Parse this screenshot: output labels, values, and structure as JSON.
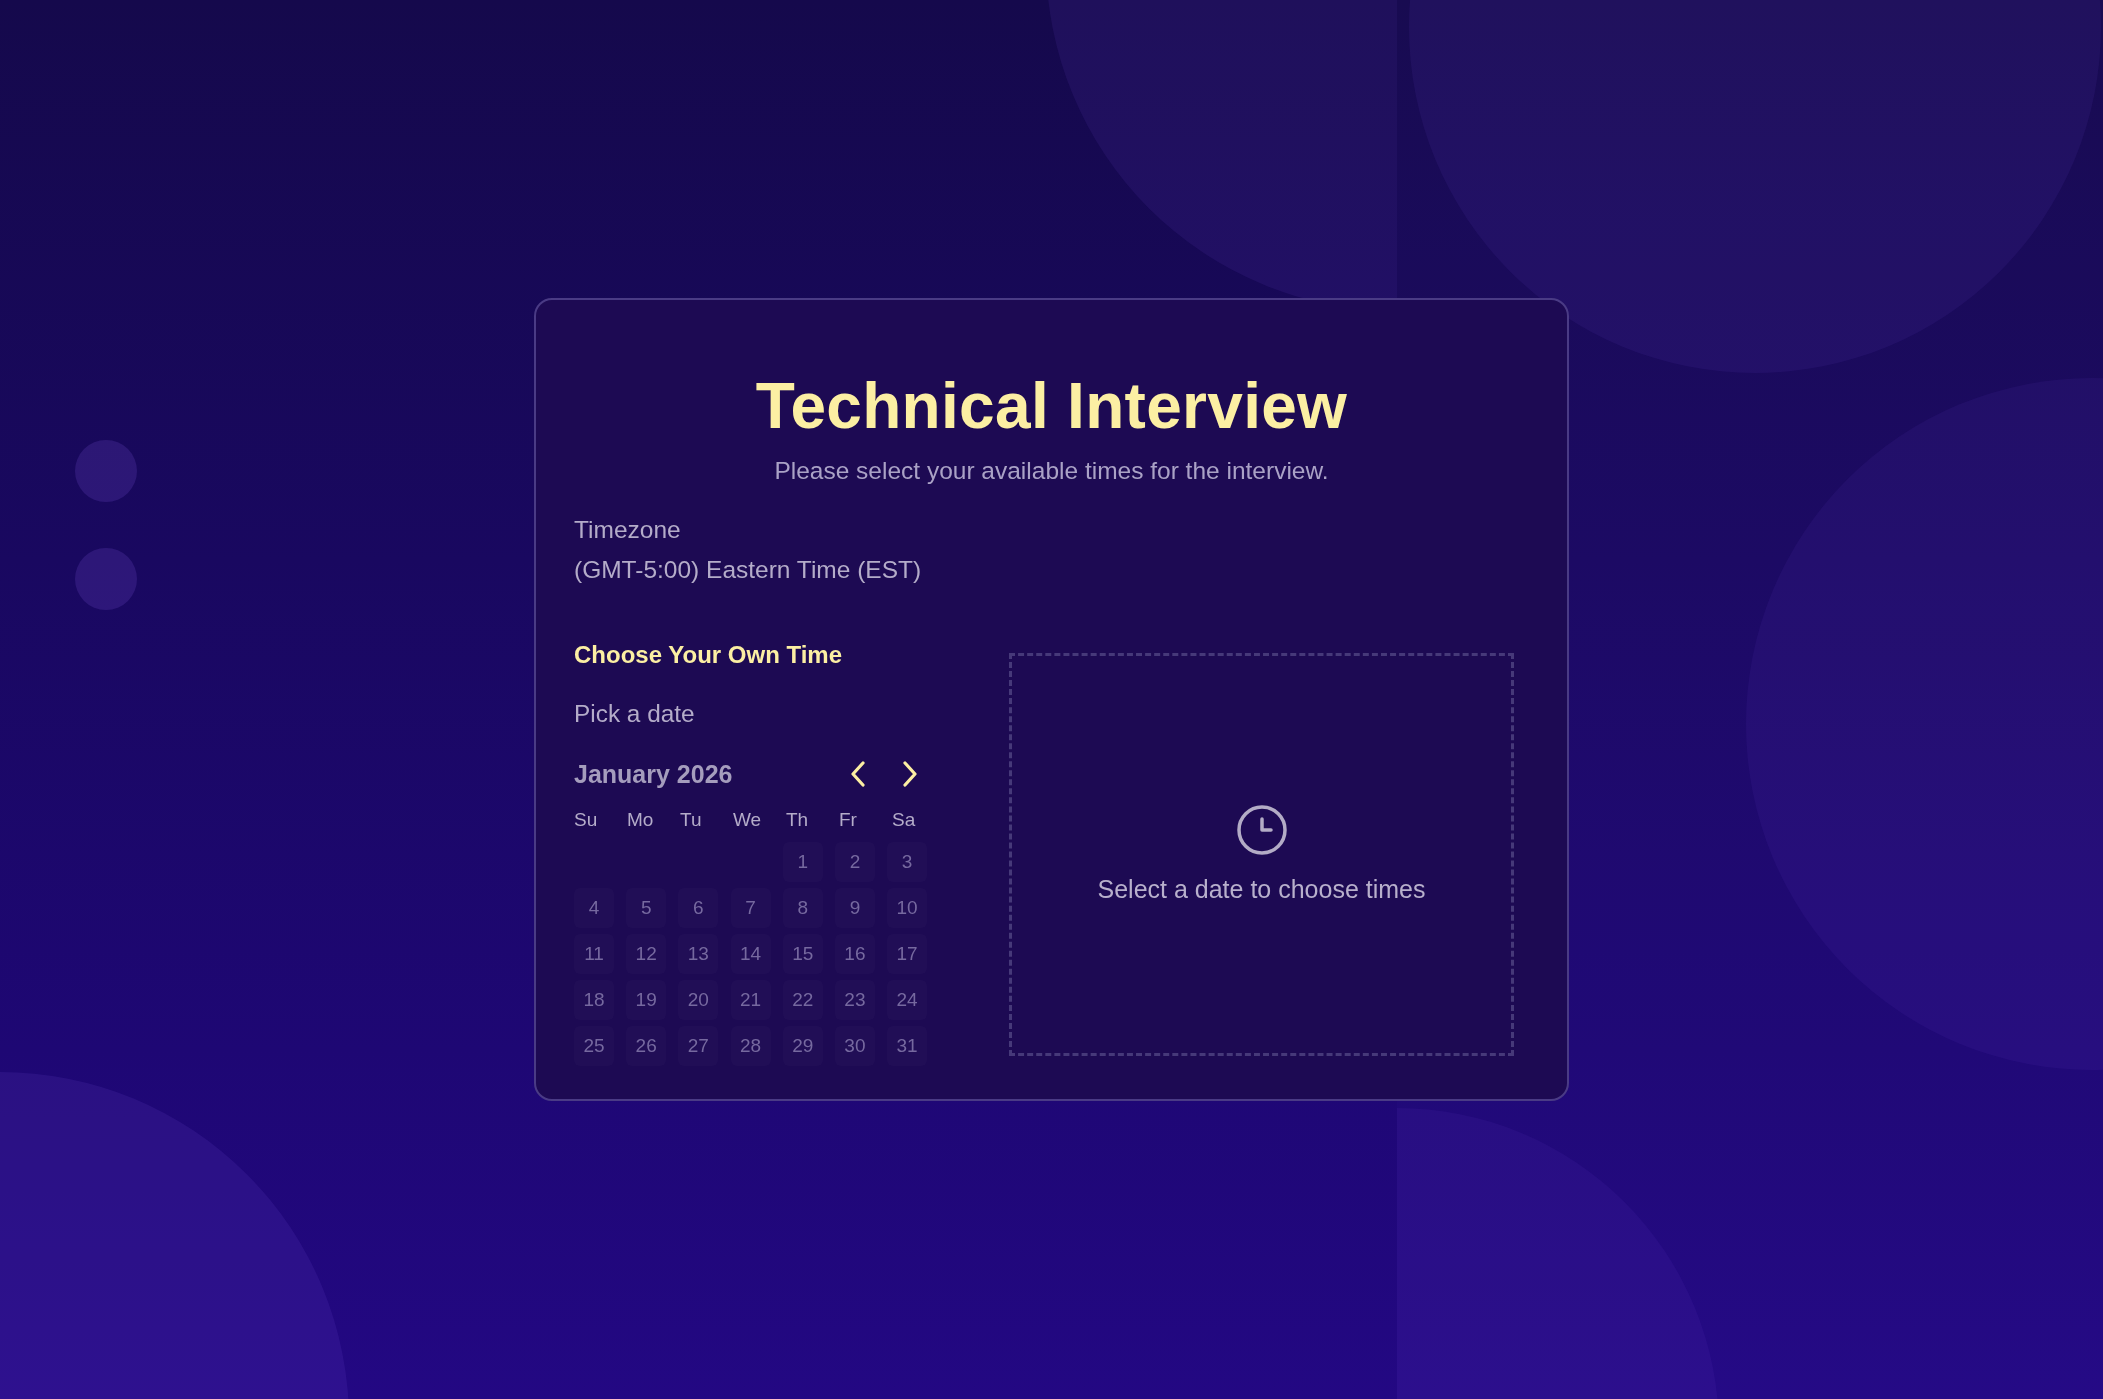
{
  "header": {
    "title": "Technical Interview",
    "subtitle": "Please select your available times for the interview."
  },
  "timezone": {
    "label": "Timezone",
    "value": "(GMT-5:00) Eastern Time (EST)"
  },
  "scheduler": {
    "heading": "Choose Your Own Time",
    "date_label": "Pick a date",
    "calendar": {
      "month": "January 2026",
      "weekdays": [
        "Su",
        "Mo",
        "Tu",
        "We",
        "Th",
        "Fr",
        "Sa"
      ],
      "weeks": [
        [
          "1",
          "2",
          "3"
        ],
        [
          "4",
          "5",
          "6",
          "7",
          "8",
          "9",
          "10"
        ],
        [
          "11",
          "12",
          "13",
          "14",
          "15",
          "16",
          "17"
        ],
        [
          "18",
          "19",
          "20",
          "21",
          "22",
          "23",
          "24"
        ],
        [
          "25",
          "26",
          "27",
          "28",
          "29",
          "30",
          "31"
        ]
      ]
    }
  },
  "time_panel": {
    "empty_message": "Select a date to choose times"
  }
}
